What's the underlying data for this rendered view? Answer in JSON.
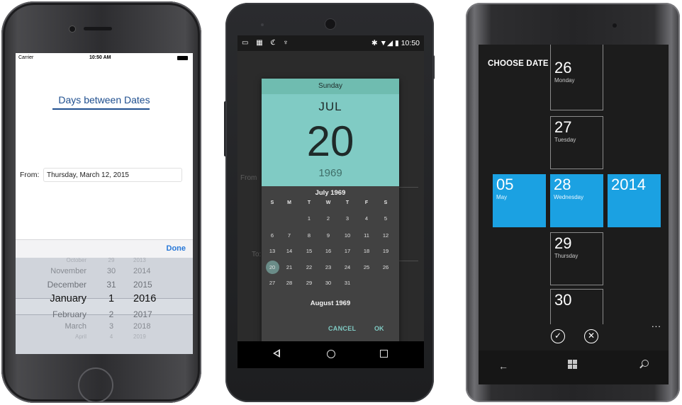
{
  "ios": {
    "carrier": "Carrier",
    "time": "10:50 AM",
    "title": "Days between Dates",
    "from_label": "From:",
    "from_value": "Thursday, March 12, 2015",
    "done_label": "Done",
    "picker": {
      "months": [
        "October",
        "November",
        "December",
        "January",
        "February",
        "March",
        "April"
      ],
      "days": [
        "29",
        "30",
        "31",
        "1",
        "2",
        "3",
        "4"
      ],
      "years": [
        "2013",
        "2014",
        "2015",
        "2016",
        "2017",
        "2018",
        "2019"
      ]
    }
  },
  "android": {
    "status_time": "10:50",
    "bg_from_label": "From",
    "bg_to_label": "To:",
    "dialog": {
      "weekday": "Sunday",
      "month": "JUL",
      "day": "20",
      "year": "1969",
      "calendar_title": "July 1969",
      "weekdays": [
        "S",
        "M",
        "T",
        "W",
        "T",
        "F",
        "S"
      ],
      "weeks": [
        [
          "",
          "",
          "1",
          "2",
          "3",
          "4",
          "5"
        ],
        [
          "6",
          "7",
          "8",
          "9",
          "10",
          "11",
          "12"
        ],
        [
          "13",
          "14",
          "15",
          "16",
          "17",
          "18",
          "19"
        ],
        [
          "20",
          "21",
          "22",
          "23",
          "24",
          "25",
          "26"
        ],
        [
          "27",
          "28",
          "29",
          "30",
          "31",
          "",
          ""
        ]
      ],
      "selected_day": "20",
      "next_month_title": "August 1969",
      "cancel_label": "CANCEL",
      "ok_label": "OK"
    }
  },
  "winphone": {
    "title": "CHOOSE DATE",
    "day_column": [
      {
        "num": "26",
        "name": "Monday"
      },
      {
        "num": "27",
        "name": "Tuesday"
      },
      {
        "num": "28",
        "name": "Wednesday"
      },
      {
        "num": "29",
        "name": "Thursday"
      },
      {
        "num": "30",
        "name": ""
      }
    ],
    "month_tile": {
      "num": "05",
      "name": "May"
    },
    "year_tile": {
      "num": "2014"
    },
    "more_label": "...",
    "check_symbol": "✓",
    "close_symbol": "✕",
    "back_symbol": "←"
  },
  "colors": {
    "ios_title": "#1f4f8f",
    "ios_done": "#2878d8",
    "android_accent": "#80cbc4",
    "wp_accent": "#1ba1e2"
  }
}
